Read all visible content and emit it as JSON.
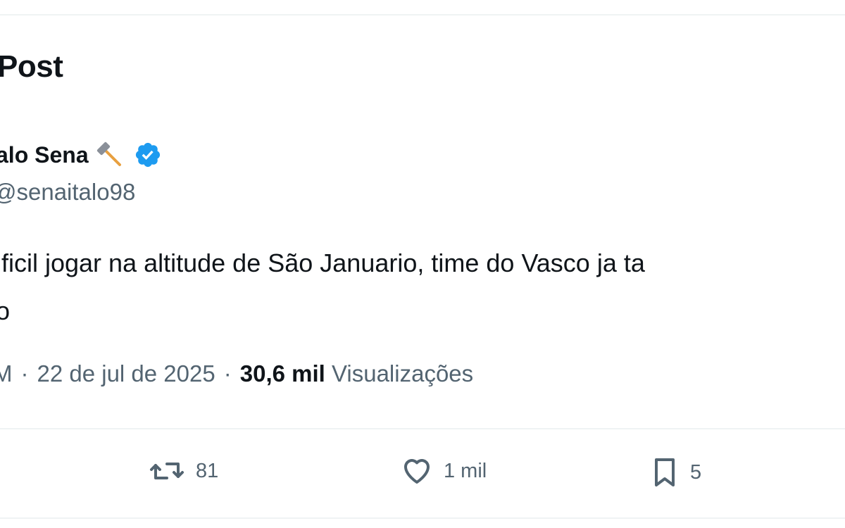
{
  "header": {
    "title": "Post"
  },
  "author": {
    "name": "alo Sena",
    "emoji_icon": "hammer-icon",
    "verified_icon": "verified-badge-icon",
    "verified_color": "#1d9bf0",
    "handle": "senaitalo98"
  },
  "post": {
    "lines": [
      "ificil jogar na altitude de São Januario, time do Vasco ja ta",
      "o"
    ]
  },
  "meta": {
    "time": "M",
    "separator": "·",
    "date": "22 de jul de 2025",
    "views_count": "30,6 mil",
    "views_label": "Visualizações"
  },
  "actions": {
    "repost": {
      "icon": "repost-icon",
      "count": "81"
    },
    "like": {
      "icon": "heart-icon",
      "count": "1 mil"
    },
    "bookmark": {
      "icon": "bookmark-icon",
      "count": "5"
    }
  },
  "colors": {
    "text": "#0f1419",
    "secondary": "#536471",
    "divider": "#eff3f4"
  }
}
